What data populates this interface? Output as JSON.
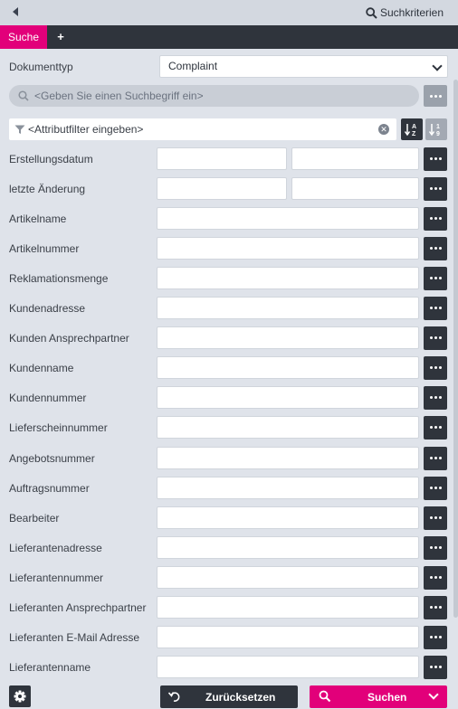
{
  "header": {
    "criteria_label": "Suchkriterien",
    "back_icon": "triangle-left-icon"
  },
  "tabs": {
    "active_label": "Suche",
    "add_label": "+"
  },
  "document_type": {
    "label": "Dokumenttyp",
    "value": "Complaint"
  },
  "search": {
    "placeholder": "<Geben Sie einen Suchbegriff ein>"
  },
  "filter": {
    "placeholder": "<Attributfilter eingeben>"
  },
  "fields": [
    {
      "label": "Erstellungsdatum",
      "range": true
    },
    {
      "label": "letzte Änderung",
      "range": true
    },
    {
      "label": "Artikelname"
    },
    {
      "label": "Artikelnummer"
    },
    {
      "label": "Reklamationsmenge"
    },
    {
      "label": "Kundenadresse"
    },
    {
      "label": "Kunden Ansprechpartner"
    },
    {
      "label": "Kundenname"
    },
    {
      "label": "Kundennummer"
    },
    {
      "label": "Lieferscheinnummer"
    },
    {
      "label": "Angebotsnummer"
    },
    {
      "label": "Auftragsnummer"
    },
    {
      "label": "Bearbeiter"
    },
    {
      "label": "Lieferantenadresse"
    },
    {
      "label": "Lieferantennummer"
    },
    {
      "label": "Lieferanten Ansprechpartner"
    },
    {
      "label": "Lieferanten E-Mail Adresse"
    },
    {
      "label": "Lieferantenname"
    }
  ],
  "footer": {
    "reset_label": "Zurücksetzen",
    "search_label": "Suchen"
  },
  "colors": {
    "accent": "#e2007a",
    "dark": "#2f343c",
    "background": "#dfe3ea"
  }
}
